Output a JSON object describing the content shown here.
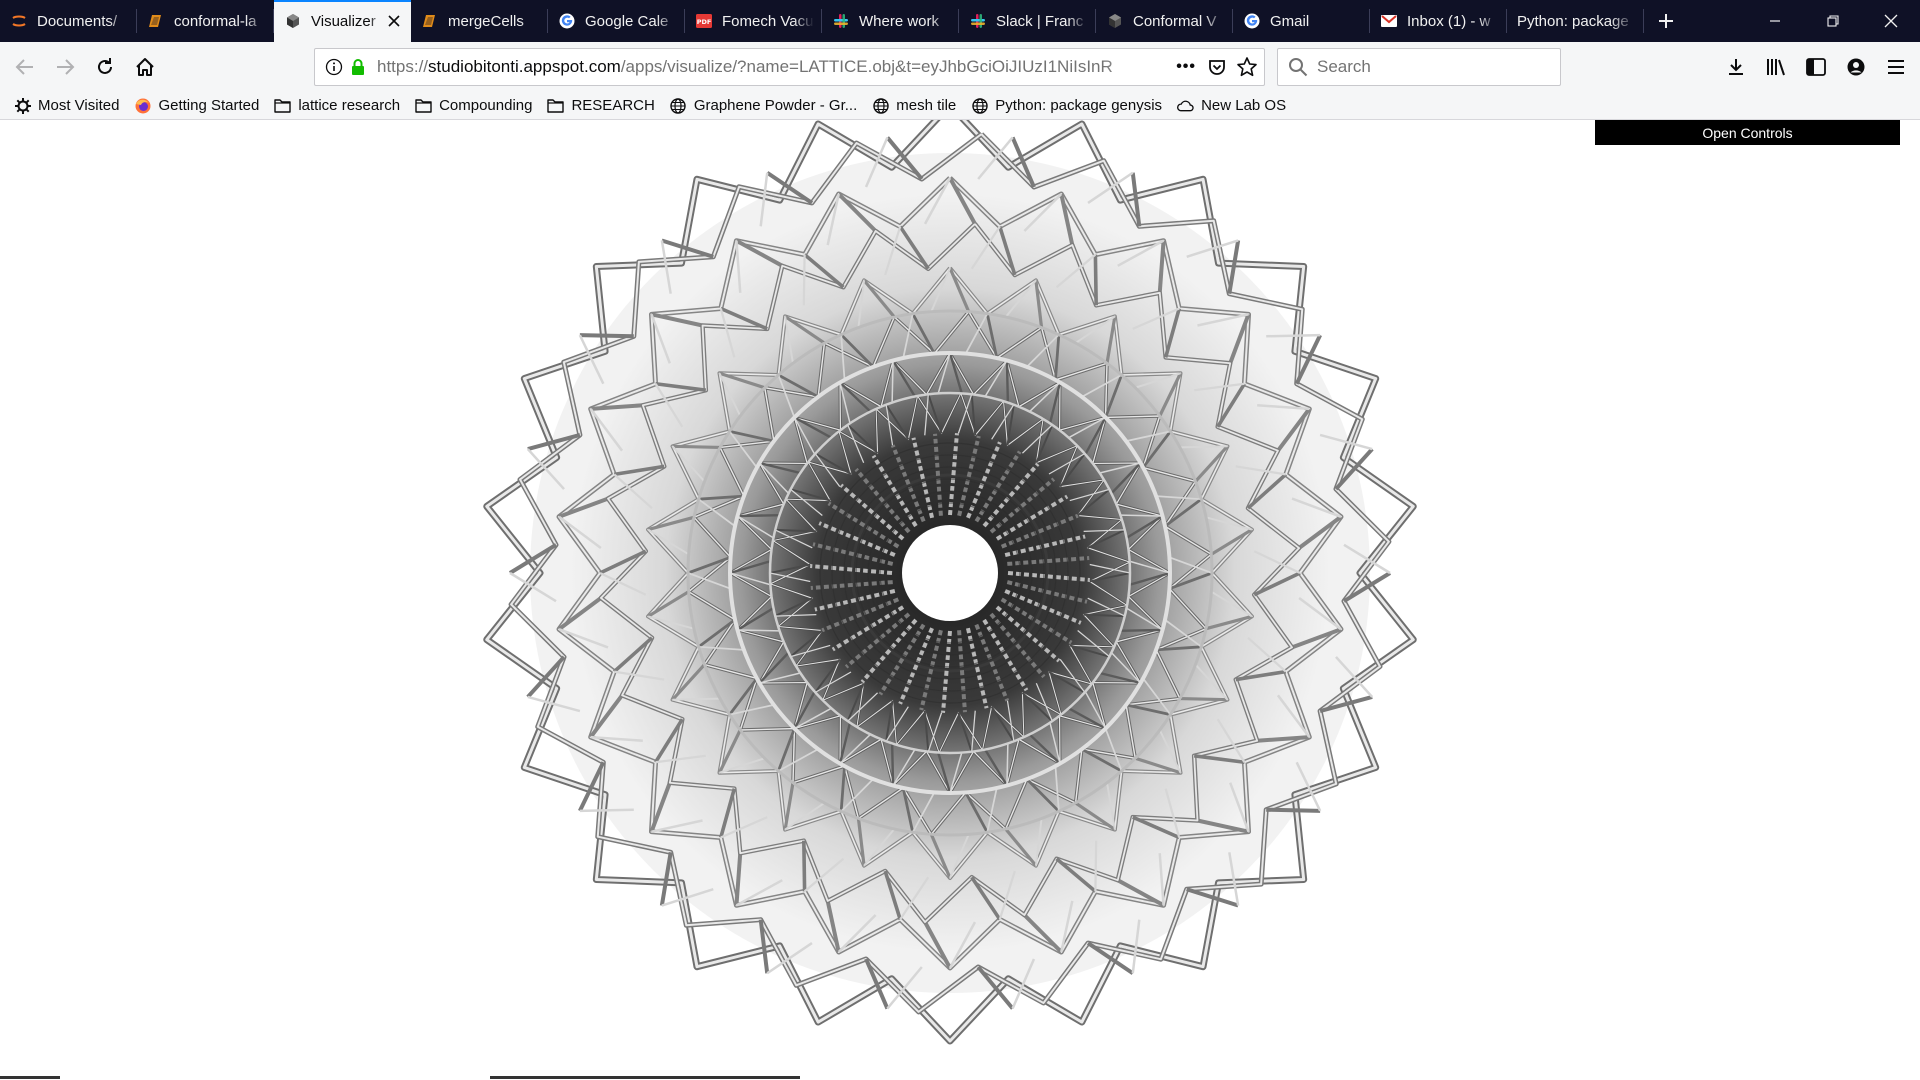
{
  "browser": {
    "tabs": [
      {
        "label": "Documents/",
        "icon": "jupyter-icon",
        "active": false
      },
      {
        "label": "conformal-la",
        "icon": "overleaf-icon",
        "active": false
      },
      {
        "label": "Visualizer",
        "icon": "cube-icon",
        "active": true
      },
      {
        "label": "mergeCells",
        "icon": "overleaf-icon",
        "active": false
      },
      {
        "label": "Google Cale",
        "icon": "google-icon",
        "active": false
      },
      {
        "label": "Fomech Vacu",
        "icon": "pdf-icon",
        "active": false
      },
      {
        "label": "Where work",
        "icon": "slack-icon",
        "active": false
      },
      {
        "label": "Slack | Franc",
        "icon": "slack-icon",
        "active": false
      },
      {
        "label": "Conformal V",
        "icon": "cube-icon",
        "active": false
      },
      {
        "label": "Gmail",
        "icon": "google-icon",
        "active": false
      },
      {
        "label": "Inbox (1) - w",
        "icon": "gmail-icon",
        "active": false
      },
      {
        "label": "Python: package",
        "icon": "none",
        "active": false
      }
    ],
    "url_domain": "studiobitonti.appspot.com",
    "url_protocol": "https://",
    "url_rest": "/apps/visualize/?name=LATTICE.obj&t=eyJhbGciOiJIUzI1NiIsInR",
    "search_placeholder": "Search",
    "page_actions_label": "•••",
    "bookmarks": [
      {
        "label": "Most Visited",
        "icon": "gear-icon"
      },
      {
        "label": "Getting Started",
        "icon": "firefox-icon"
      },
      {
        "label": "lattice research",
        "icon": "folder-icon"
      },
      {
        "label": "Compounding",
        "icon": "folder-icon"
      },
      {
        "label": "RESEARCH",
        "icon": "folder-icon"
      },
      {
        "label": "Graphene Powder - Gr...",
        "icon": "globe-icon"
      },
      {
        "label": "mesh tile",
        "icon": "globe-icon"
      },
      {
        "label": "Python: package genysis",
        "icon": "globe-icon"
      },
      {
        "label": "New Lab OS",
        "icon": "cloud-icon"
      }
    ]
  },
  "page": {
    "open_controls_label": "Open Controls",
    "viewer_model": "lattice-ring-3d-mesh"
  },
  "colors": {
    "tabstrip_bg": "#0f1126",
    "toolbar_bg": "#f5f6f7",
    "active_tab_accent": "#0a84ff",
    "lock_green": "#12bc00",
    "controls_bg": "#000000"
  }
}
